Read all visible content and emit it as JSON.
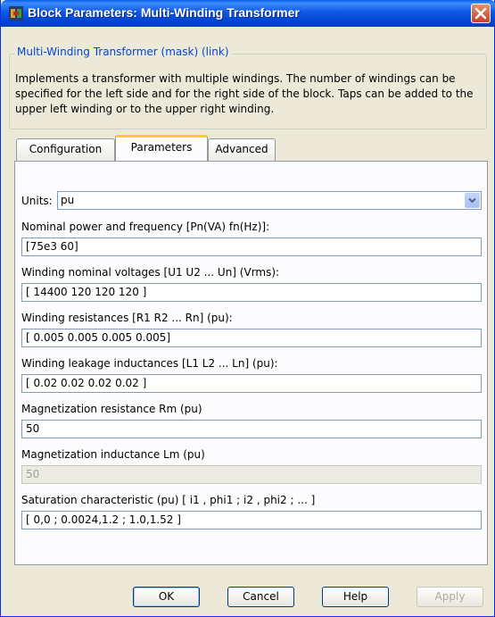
{
  "window": {
    "title": "Block Parameters: Multi-Winding Transformer",
    "accent_color": "#0a5de6",
    "close_icon": "close-icon"
  },
  "mask": {
    "group_label": "Multi-Winding Transformer (mask) (link)",
    "description": "Implements a transformer with multiple windings. The number of windings can be specified for the left side and for the right side of the block.  Taps can be added to the upper left winding or  to the upper right winding."
  },
  "tabs": [
    {
      "label": "Configuration"
    },
    {
      "label": "Parameters"
    },
    {
      "label": "Advanced"
    }
  ],
  "params": {
    "units_label": "Units:",
    "units_value": "pu",
    "nominal_label": "Nominal power and frequency [Pn(VA) fn(Hz)]:",
    "nominal_value": "[75e3 60]",
    "voltages_label": "Winding nominal voltages [U1 U2 ... Un] (Vrms):",
    "voltages_value": "[ 14400  120  120 120 ]",
    "resistances_label": "Winding resistances [R1 R2 ... Rn] (pu):",
    "resistances_value": "[ 0.005  0.005  0.005  0.005]",
    "inductances_label": "Winding leakage inductances [L1 L2 ... Ln] (pu):",
    "inductances_value": "[ 0.02  0.02  0.02  0.02 ]",
    "rm_label": "Magnetization resistance  Rm (pu)",
    "rm_value": "50",
    "lm_label": "Magnetization inductance Lm (pu)",
    "lm_value": "50",
    "saturation_label": "Saturation characteristic (pu) [ i1 ,  phi1 ;  i2 , phi2 ; ... ]",
    "saturation_value": "[ 0,0 ; 0.0024,1.2 ; 1.0,1.52 ]"
  },
  "buttons": {
    "ok": "OK",
    "cancel": "Cancel",
    "help": "Help",
    "apply": "Apply"
  }
}
